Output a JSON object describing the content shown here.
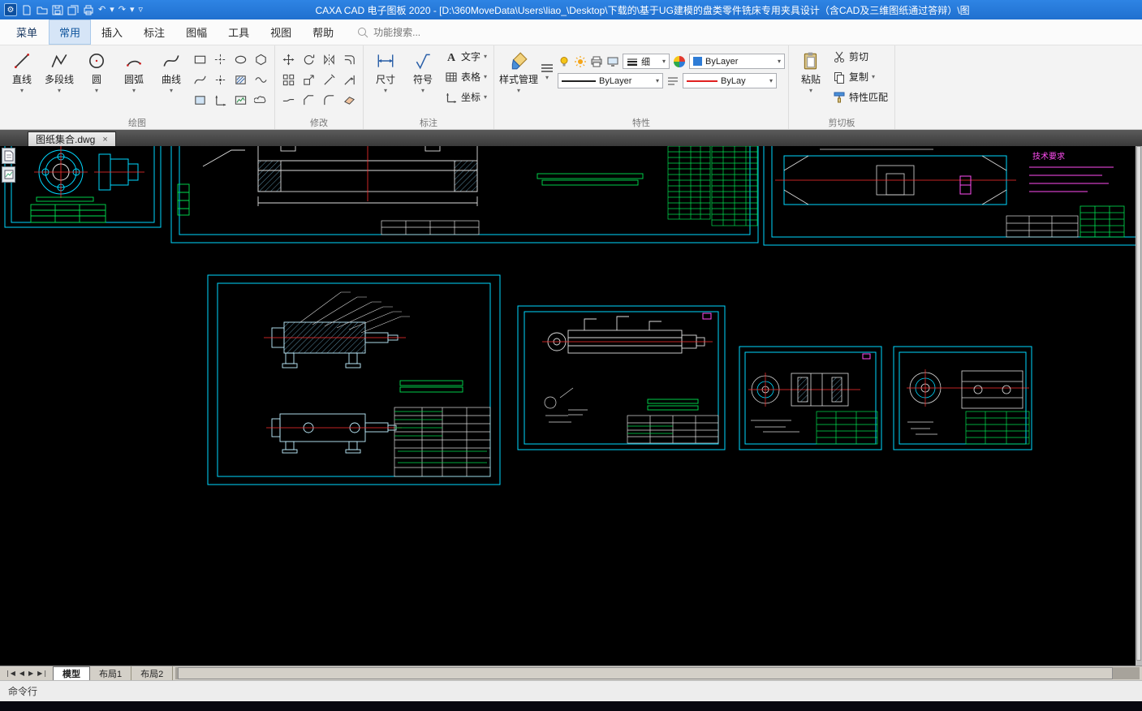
{
  "window": {
    "title": "CAXA CAD 电子图板 2020 - [D:\\360MoveData\\Users\\liao_\\Desktop\\下载的\\基于UG建模的盘类零件铣床专用夹具设计（含CAD及三维图纸通过答辩）\\图"
  },
  "menubar": {
    "menu_button": "菜单",
    "tabs": [
      {
        "label": "常用",
        "active": true
      },
      {
        "label": "插入"
      },
      {
        "label": "标注"
      },
      {
        "label": "图幅"
      },
      {
        "label": "工具"
      },
      {
        "label": "视图"
      },
      {
        "label": "帮助"
      }
    ],
    "search_placeholder": "功能搜索..."
  },
  "ribbon": {
    "draw": {
      "label": "绘图",
      "big_tools": [
        "直线",
        "多段线",
        "圆",
        "圆弧",
        "曲线"
      ],
      "small_icons": [
        "rectangle",
        "centerline",
        "ellipse",
        "polygon",
        "spline",
        "point",
        "hatch",
        "wave",
        "region",
        "axis",
        "raster",
        "cloud"
      ]
    },
    "modify": {
      "label": "修改",
      "icons": [
        "move",
        "rotate",
        "mirror",
        "offset",
        "array",
        "scale",
        "trim",
        "extend",
        "break",
        "chamfer",
        "fillet",
        "erase"
      ]
    },
    "annotate": {
      "label": "标注",
      "big_tools": [
        "尺寸",
        "符号"
      ],
      "small_tools": [
        "文字",
        "表格",
        "坐标"
      ]
    },
    "properties": {
      "label": "特性",
      "style_manager": "样式管理",
      "lineweight_label": "细",
      "linetype_value": "ByLayer",
      "color_value": "ByLayer",
      "width_value": "ByLay"
    },
    "clipboard": {
      "label": "剪切板",
      "paste": "粘贴",
      "cut": "剪切",
      "copy": "复制",
      "match": "特性匹配"
    }
  },
  "document_tab": {
    "label": "图纸集合.dwg",
    "close": "×"
  },
  "canvas": {
    "tech_note_title": "技术要求"
  },
  "bottom_bar": {
    "tabs": [
      {
        "label": "模型",
        "active": true
      },
      {
        "label": "布局1"
      },
      {
        "label": "布局2"
      }
    ]
  },
  "command_line": {
    "label": "命令行"
  }
}
